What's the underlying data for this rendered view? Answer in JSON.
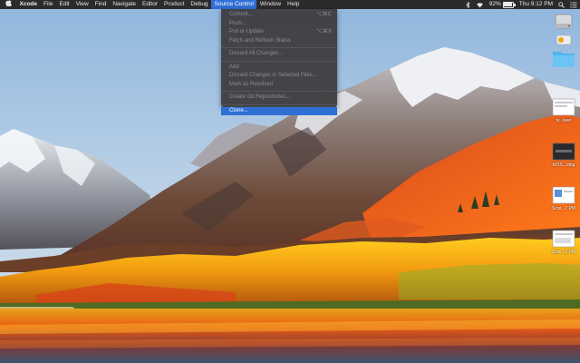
{
  "menubar": {
    "app_name": "Xcode",
    "items": [
      "File",
      "Edit",
      "View",
      "Find",
      "Navigate",
      "Editor",
      "Product",
      "Debug",
      "Source Control",
      "Window",
      "Help"
    ],
    "active_item": "Source Control",
    "battery_percent": "92%",
    "battery_level": 0.92,
    "clock": "Thu 9:12 PM"
  },
  "source_control_menu": {
    "items": [
      {
        "label": "Commit...",
        "shortcut": "⌥⌘C"
      },
      {
        "label": "Push...",
        "shortcut": ""
      },
      {
        "label": "Pull or Update",
        "shortcut": "⌥⌘X"
      },
      {
        "label": "Fetch and Refresh Status",
        "shortcut": ""
      },
      {
        "label": "Discard All Changes...",
        "shortcut": ""
      },
      {
        "label": "Add",
        "shortcut": ""
      },
      {
        "label": "Discard Changes in Selected Files...",
        "shortcut": ""
      },
      {
        "label": "Mark as Resolved",
        "shortcut": ""
      },
      {
        "label": "Create Git Repositories...",
        "shortcut": ""
      },
      {
        "label": "Clone...",
        "shortcut": ""
      }
    ],
    "highlighted": "Clone..."
  },
  "desktop": {
    "icons": [
      {
        "name": "hard-drive-icon",
        "label": ""
      },
      {
        "name": "disk-image-icon",
        "label": ""
      },
      {
        "name": "folder-icon",
        "label": ""
      },
      {
        "name": "screenshot-file-icon",
        "label": "tv...lwer"
      },
      {
        "name": "screenshot-file-icon",
        "label": "tvOS...ding"
      },
      {
        "name": "screenshot-file-icon",
        "label": "Scre...7 PM"
      },
      {
        "name": "screenshot-file-icon",
        "label": "Scre...2 PM"
      }
    ]
  },
  "colors": {
    "menubar_bg": "#2b2b2d",
    "menu_highlight": "#2f6fd6",
    "folder_blue": "#4fb3f0"
  }
}
